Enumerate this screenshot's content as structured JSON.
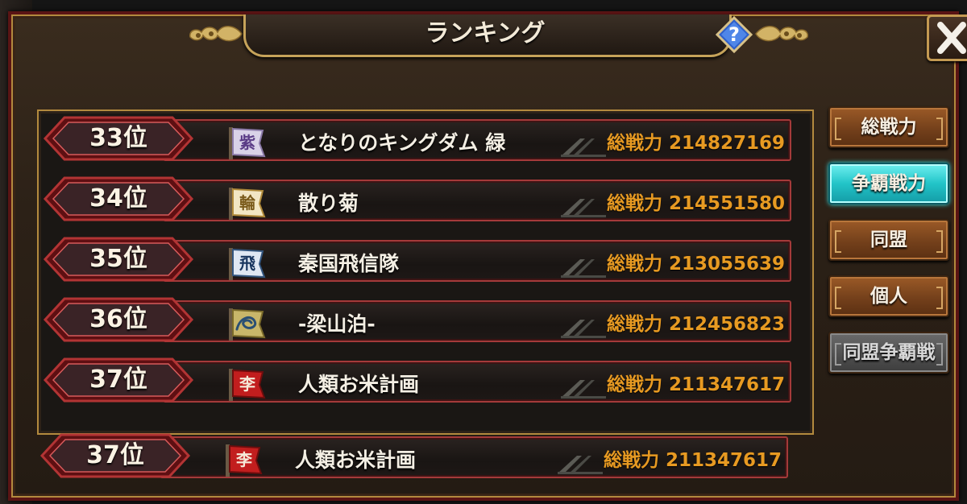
{
  "window": {
    "title": "ランキング"
  },
  "ranking_list": [
    {
      "rank": "33位",
      "flag_char": "紫",
      "flag_style": "purple",
      "name": "となりのキングダム 緑",
      "power": "総戦力 214827169"
    },
    {
      "rank": "34位",
      "flag_char": "輪",
      "flag_style": "gold",
      "name": "散り菊",
      "power": "総戦力 214551580"
    },
    {
      "rank": "35位",
      "flag_char": "飛",
      "flag_style": "blue",
      "name": "秦国飛信隊",
      "power": "総戦力 213055639"
    },
    {
      "rank": "36位",
      "flag_char": "",
      "flag_style": "dragon",
      "name": "-梁山泊-",
      "power": "総戦力 212456823"
    },
    {
      "rank": "37位",
      "flag_char": "李",
      "flag_style": "red",
      "name": "人類お米計画",
      "power": "総戦力 211347617"
    }
  ],
  "own_entry": {
    "rank": "37位",
    "flag_char": "李",
    "flag_style": "red",
    "name": "人類お米計画",
    "power": "総戦力 211347617"
  },
  "tabs": [
    {
      "label": "総戦力",
      "state": "normal"
    },
    {
      "label": "争覇戦力",
      "state": "active"
    },
    {
      "label": "同盟",
      "state": "normal"
    },
    {
      "label": "個人",
      "state": "normal"
    },
    {
      "label": "同盟争覇戦",
      "state": "disabled"
    }
  ],
  "colors": {
    "frame_red": "#5a1414",
    "gold_trim": "#b38a3e",
    "power_orange": "#e79a22",
    "tab_brown": "#74401b",
    "tab_active_cyan": "#22c4c8",
    "tab_disabled_gray": "#505050"
  },
  "icons": {
    "help": "question-diamond-icon",
    "close": "close-x-icon",
    "rank_badge": "diamond-rank-badge",
    "alliance_flag": "alliance-flag-icon"
  }
}
